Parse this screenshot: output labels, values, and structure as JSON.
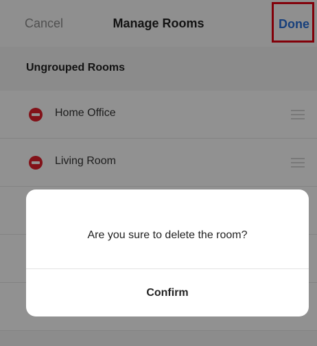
{
  "navbar": {
    "cancel_label": "Cancel",
    "title": "Manage Rooms",
    "done_label": "Done"
  },
  "section": {
    "label": "Ungrouped Rooms"
  },
  "rooms": [
    {
      "label": "Home Office",
      "delete_icon": "minus-circle-icon",
      "drag_icon": "drag-handle-icon"
    },
    {
      "label": "Living Room",
      "delete_icon": "minus-circle-icon",
      "drag_icon": "drag-handle-icon"
    }
  ],
  "dialog": {
    "message": "Are you sure to delete the room?",
    "confirm_label": "Confirm"
  },
  "colors": {
    "accent": "#2a6fd6",
    "delete": "#e0202b",
    "highlight": "#e10010"
  }
}
